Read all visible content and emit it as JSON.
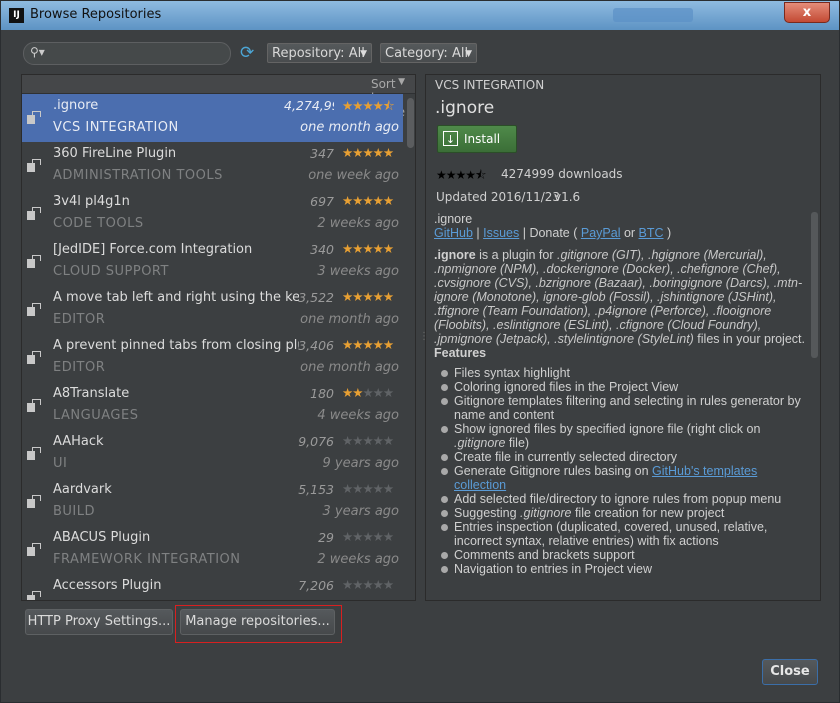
{
  "window": {
    "title": "Browse Repositories",
    "logo": "IJ",
    "close_glyph": "x"
  },
  "toolbar": {
    "search_placeholder": "",
    "repository": "Repository: All",
    "category": "Category: All"
  },
  "sort_label": "Sort by: name",
  "plugins": [
    {
      "name": ".ignore",
      "downloads": "4,274,999",
      "stars": 4.5,
      "category": "VCS INTEGRATION",
      "updated": "one month ago",
      "selected": true
    },
    {
      "name": "360 FireLine Plugin",
      "downloads": "347",
      "stars": 5,
      "category": "ADMINISTRATION TOOLS",
      "updated": "one week ago"
    },
    {
      "name": "3v4l pl4g1n",
      "downloads": "697",
      "stars": 5,
      "category": "CODE TOOLS",
      "updated": "2 weeks ago"
    },
    {
      "name": "[JedIDE] Force.com Integration",
      "downloads": "340",
      "stars": 5,
      "category": "CLOUD SUPPORT",
      "updated": "3 weeks ago"
    },
    {
      "name": "A move tab left and right using the keyboard",
      "downloads": "3,522",
      "stars": 5,
      "category": "EDITOR",
      "updated": "one month ago"
    },
    {
      "name": "A prevent pinned tabs from closing plugin",
      "downloads": "3,406",
      "stars": 5,
      "category": "EDITOR",
      "updated": "one month ago"
    },
    {
      "name": "A8Translate",
      "downloads": "180",
      "stars": 2,
      "category": "LANGUAGES",
      "updated": "4 weeks ago"
    },
    {
      "name": "AAHack",
      "downloads": "9,076",
      "stars": 0,
      "category": "UI",
      "updated": "9 years ago"
    },
    {
      "name": "Aardvark",
      "downloads": "5,153",
      "stars": 0,
      "category": "BUILD",
      "updated": "3 years ago"
    },
    {
      "name": "ABACUS Plugin",
      "downloads": "29",
      "stars": 0,
      "category": "FRAMEWORK INTEGRATION",
      "updated": "2 weeks ago"
    },
    {
      "name": "Accessors Plugin",
      "downloads": "7,206",
      "stars": 0,
      "category": "",
      "updated": ""
    }
  ],
  "detail": {
    "category": "VCS INTEGRATION",
    "name": ".ignore",
    "install_label": "Install",
    "rating": 4.5,
    "downloads_text": "4274999 downloads",
    "updated_text": "Updated 2016/11/23",
    "version": "v1.6",
    "desc_title": ".ignore",
    "links": {
      "github": "GitHub",
      "sep1": " | ",
      "issues": "Issues",
      "donate_pre": " | Donate ( ",
      "paypal": "PayPal",
      "or": " or ",
      "btc": "BTC",
      "donate_post": " )"
    },
    "intro_bold": ".ignore",
    "intro_rest": " is a plugin for ",
    "intro_files": ".gitignore (GIT), .hgignore (Mercurial), .npmignore (NPM), .dockerignore (Docker), .chefignore (Chef), .cvsignore (CVS), .bzrignore (Bazaar), .boringignore (Darcs), .mtn-ignore (Monotone), ignore-glob (Fossil), .jshintignore (JSHint), .tfignore (Team Foundation), .p4ignore (Perforce), .flooignore (Floobits), .eslintignore (ESLint), .cfignore (Cloud Foundry), .jpmignore (Jetpack), .stylelintignore (StyleLint)",
    "intro_tail": " files in your project.",
    "features_title": "Features",
    "features": [
      "Files syntax highlight",
      "Coloring ignored files in the Project View",
      "Gitignore templates filtering and selecting in rules generator by name and content",
      "Show ignored files by specified ignore file (right click on .gitignore file)",
      "Create file in currently selected directory",
      "Generate Gitignore rules basing on GitHub's templates collection",
      "Add selected file/directory to ignore rules from popup menu",
      "Suggesting .gitignore file creation for new project",
      "Entries inspection (duplicated, covered, unused, relative, incorrect syntax, relative entries) with fix actions",
      "Comments and brackets support",
      "Navigation to entries in Project view"
    ],
    "gh_templates_pre": "Generate Gitignore rules basing on ",
    "gh_templates_link": "GitHub's templates collection"
  },
  "buttons": {
    "proxy": "HTTP Proxy Settings...",
    "manage": "Manage repositories...",
    "close": "Close"
  },
  "colors": {
    "selection": "#4b6eaf",
    "star": "#e8a033",
    "install": "#4f8a4a",
    "link": "#5a9bd6",
    "highlight_box": "#d82020"
  }
}
